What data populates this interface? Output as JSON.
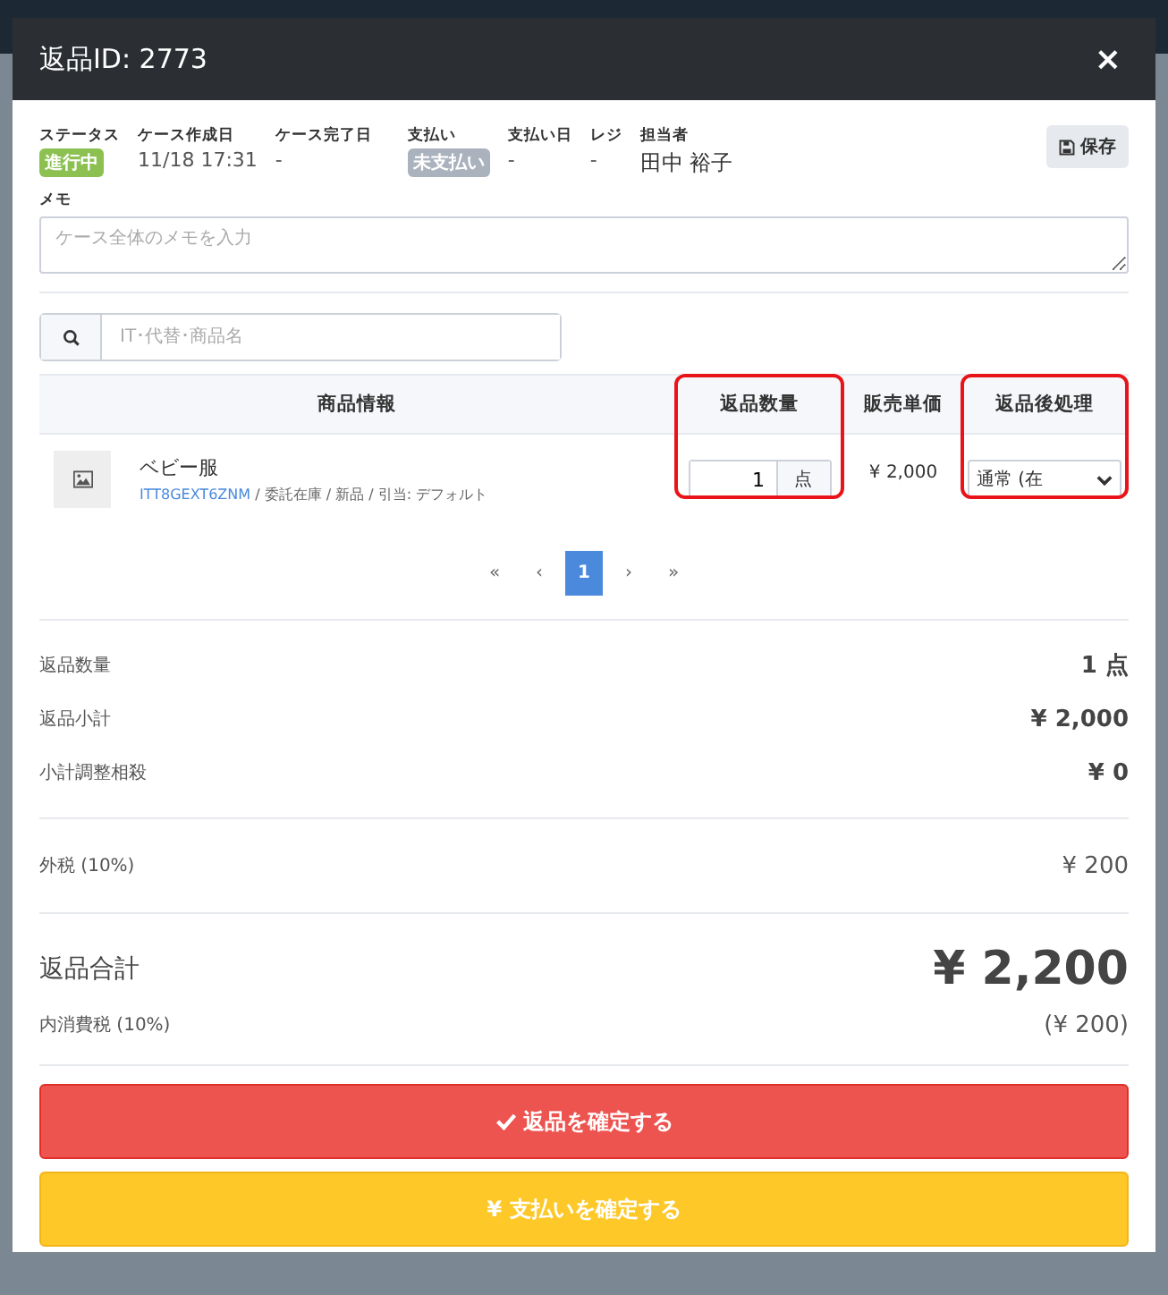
{
  "modal": {
    "title": "返品ID: 2773",
    "close": "×"
  },
  "info": [
    {
      "label": "ステータス",
      "value": "進行中",
      "kind": "badge",
      "color": "#8cc152"
    },
    {
      "label": "ケース作成日",
      "value": "11/18 17:31",
      "kind": "text"
    },
    {
      "label": "ケース完了日",
      "value": "-",
      "kind": "text"
    },
    {
      "label": "支払い",
      "value": "未支払い",
      "kind": "badge",
      "color": "#aab2bd"
    },
    {
      "label": "支払い日",
      "value": "-",
      "kind": "text"
    },
    {
      "label": "レジ",
      "value": "-",
      "kind": "text"
    },
    {
      "label": "担当者",
      "value": "田中 裕子",
      "kind": "large"
    }
  ],
  "save_button": "保存",
  "memo": {
    "label": "メモ",
    "placeholder": "ケース全体のメモを入力"
  },
  "search": {
    "placeholder": "IT･代替･商品名"
  },
  "table": {
    "columns": [
      {
        "label": "商品情報",
        "highlighted": false
      },
      {
        "label": "返品数量",
        "highlighted": true
      },
      {
        "label": "販売単価",
        "highlighted": false
      },
      {
        "label": "返品後処理",
        "highlighted": true
      }
    ],
    "rows": [
      {
        "name": "ベビー服",
        "code": "ITT8GEXT6ZNM",
        "detail": " / 委託在庫 / 新品 / 引当: デフォルト",
        "quantity": "1",
        "unit": "点",
        "price": "¥ 2,000",
        "processing": "通常 (在"
      }
    ]
  },
  "pagination": [
    {
      "label": "«",
      "selected": false
    },
    {
      "label": "‹",
      "selected": false
    },
    {
      "label": "1",
      "selected": true
    },
    {
      "label": "›",
      "selected": false
    },
    {
      "label": "»",
      "selected": false
    }
  ],
  "summary": [
    {
      "label": "返品数量",
      "value": "1 点"
    },
    {
      "label": "返品小計",
      "value": "¥ 2,000"
    },
    {
      "label": "小計調整相殺",
      "value": "¥ 0"
    }
  ],
  "tax": {
    "label": "外税 (10%)",
    "value": "¥ 200"
  },
  "total": {
    "label": "返品合計",
    "value": "¥ 2,200",
    "inner_label": "内消費税 (10%)",
    "inner_value": "(¥ 200)"
  },
  "buttons": [
    {
      "label": "返品を確定する",
      "kind": "confirm"
    },
    {
      "label": "¥ 支払いを確定する",
      "kind": "payment"
    }
  ]
}
